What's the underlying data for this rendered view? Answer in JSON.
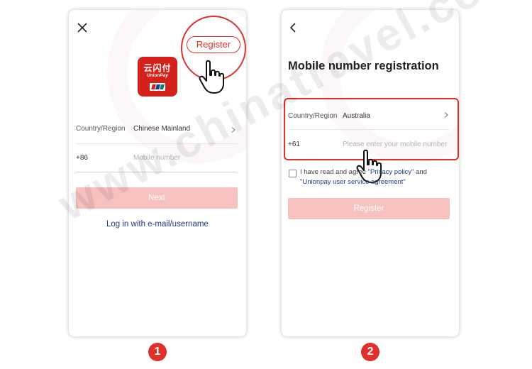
{
  "screen1": {
    "register_label": "Register",
    "logo_cn": "云闪付",
    "logo_en": "UnionPay",
    "country_label": "Country/Region",
    "country_value": "Chinese Mainland",
    "phone_prefix": "+86",
    "phone_placeholder": "Mobile number",
    "next_label": "Next",
    "login_link": "Log in with e-mail/username"
  },
  "screen2": {
    "title": "Mobile number registration",
    "country_label": "Country/Region",
    "country_value": "Australia",
    "phone_prefix": "+61",
    "phone_placeholder": "Please enter your mobile number",
    "agree_text": "I have read and agree ",
    "privacy_link": "\"Privacy policy\"",
    "and_text": " and ",
    "service_link": "\"Unionpay user service agreement\"",
    "register_label": "Register"
  },
  "steps": {
    "one": "1",
    "two": "2"
  },
  "watermark": "www.chinatravel.com",
  "colors": {
    "accent": "#e0302a",
    "button_disabled": "#f6c1bf",
    "link": "#1e3a8a"
  },
  "icons": [
    "close-icon",
    "back-icon",
    "chevron-right-icon",
    "hand-pointer-icon",
    "unionpay-logo"
  ]
}
